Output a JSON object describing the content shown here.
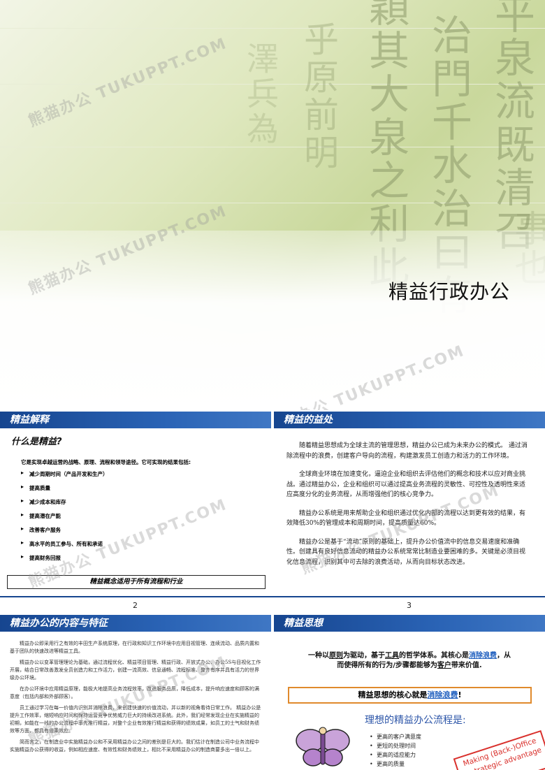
{
  "cover": {
    "title": "精益行政办公",
    "callig_cols": [
      "平泉流既清召",
      "治門千水治曰有",
      "穎其大泉之利此",
      "乎原前明",
      "澤兵為",
      "事也"
    ]
  },
  "watermark": "熊猫办公 TUKUPPT.COM",
  "slide2": {
    "header": "精益解释",
    "question": "什么是精益?",
    "intro": "它是实现卓越运营的战略、原理、流程和领导途径。它可实现的结果包括:",
    "bullets": [
      "减少周期时间（产品开发和生产）",
      "提高质量",
      "减少成本和库存",
      "提高潜在产能",
      "改善客户服务",
      "高水平的员工参与、所有和承诺",
      "提高财务回报"
    ],
    "box": "精益概念适用于所有流程和行业",
    "page": "2"
  },
  "slide3": {
    "header": "精益的益处",
    "paragraphs": [
      "随着精益思想成为全球主流的管理思想，精益办公已成为未来办公的模式。 通过消除流程中的浪费，创建客户导向的流程，构建激发员工创造力和活力的工作环境。",
      "全球商业环境在加速变化，逼迫企业和组织去评估他们的概念和技术以应对商业挑战。通过精益办公，企业和组织可以通过提高业务流程的灵敏性、可控性及透明性来适应高度分化的业务流程，从而增强他们的核心竞争力。",
      "精益办公系统是用来帮助企业和组织通过优化内部的流程以达到更有效的结果，有效降低30%的管理成本和周期时间，提高质量达60%。",
      "精益办公是基于“流动”原则的基础上，提升办公价值流中的信息交易速度和准确性。创建具有良好信息流动的精益办公系统常常比制造业要困难的多。关键是必须目视化信息流程，识别其中可去除的浪费活动，从而向目标状态改进。"
    ],
    "page": "3"
  },
  "slide4": {
    "header": "精益办公的内容与特征",
    "paragraphs": [
      "精益办公即采用行之有效的丰田生产系统原理，在行政和知识工作环境中应用目视管理、连续流动、品质内置和基于团队的快速改进等精益工具。",
      "精益办公以变革管理理论为基础，通过流程优化、精益项目管理、精益行政、开放式办公、办公5S与目视化工作开展，结合日常改善激发全员创造力和工作活力，创建一流高效、信息通畅、流程标准、整齐有序并具有活力的世界级办公环境。",
      "在办公环境中应用精益原理，能极大地提高业务流程效率，改进服务品质，降低成本，提升响应速度和顾客的满意度（包括内部和外部顾客）。",
      "员工通过学习在每一价值内识别并消除浪费，来创建快速的价值流动，并以新的视角看待日常工作。 精益办公是提升工作效率，缩短响应时间和保持运营竞争优势威力巨大的持续改进系统。此外，我们经常发现企业在实施精益的初期，如能在一线的办公流程中率先推行精益，对整个企业有效推行精益和获得的绩效成果，如员工的士气和财务绩效等方面，都具有倍乘效应。",
      "简而言之，在制造业中实施精益办公和不采用精益办公之间的差别是巨大的。我们估计在制造公司中业务流程中实施精益办公获得的收益，例如相应速度、有效性和财务绩效上，相比不采用精益办公的制造商要多出一倍以上。"
    ]
  },
  "slide5": {
    "header": "精益思想",
    "line1": {
      "a": "一种以",
      "b": "原则",
      "c": "为驱动，基于",
      "d": "工具",
      "e": "的哲学体系。其核心是",
      "f": "消除浪费",
      "g": "，从"
    },
    "line2": {
      "a": "而使得所有的行为/步骤都能够为",
      "b": "客户",
      "c": "带来价值."
    },
    "box": {
      "a": "精益思想的核心就是",
      "b": "消除浪费",
      "c": "!"
    },
    "ideal_title": "理想的精益办公流程是:",
    "ideal_items": [
      "更高的客户满意度",
      "更短的处理时间",
      "更高的适应能力",
      "更高的质量"
    ],
    "stamp": [
      "Making (Back-)Office",
      "a strategic advantage"
    ]
  }
}
